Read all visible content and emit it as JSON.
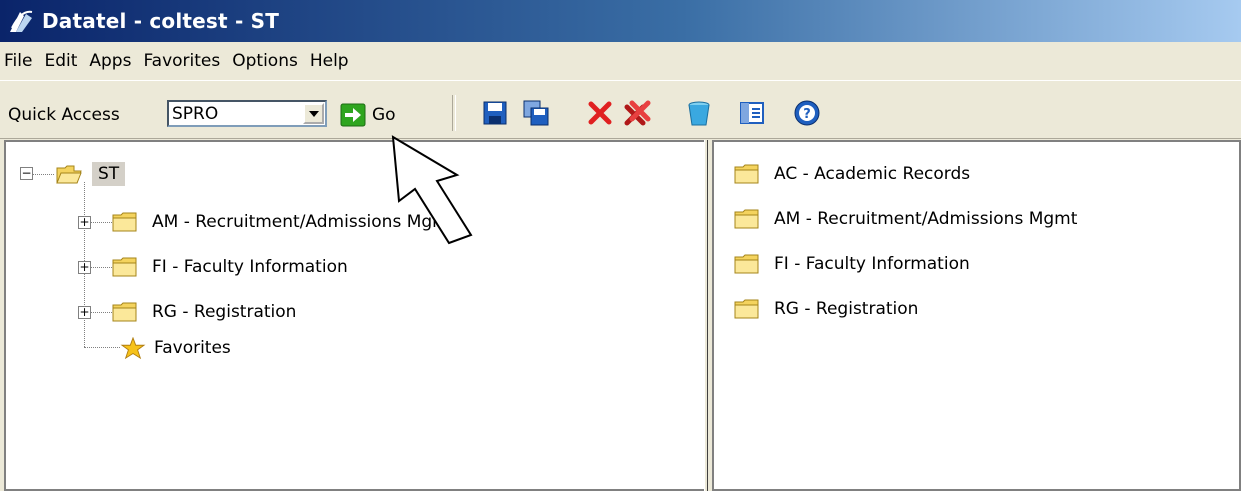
{
  "window": {
    "title": "Datatel - coltest - ST"
  },
  "menu": [
    "File",
    "Edit",
    "Apps",
    "Favorites",
    "Options",
    "Help"
  ],
  "toolbar": {
    "quick_access_label": "Quick Access",
    "quick_access_value": "SPRO",
    "go_label": "Go",
    "icons": [
      "save-icon",
      "save-all-icon",
      "cancel-icon",
      "cancel-all-icon",
      "trash-icon",
      "view-icon",
      "help-icon"
    ]
  },
  "tree": {
    "root": "ST",
    "children": [
      "AM - Recruitment/Admissions Mgmt",
      "FI - Faculty Information",
      "RG - Registration"
    ],
    "favorites": "Favorites"
  },
  "list": [
    "AC - Academic Records",
    "AM - Recruitment/Admissions Mgmt",
    "FI - Faculty Information",
    "RG - Registration"
  ],
  "colors": {
    "title_gradient_start": "#0a246a",
    "title_gradient_end": "#a6caf0",
    "chrome": "#ece9d8",
    "folder": "#f4d35e"
  }
}
